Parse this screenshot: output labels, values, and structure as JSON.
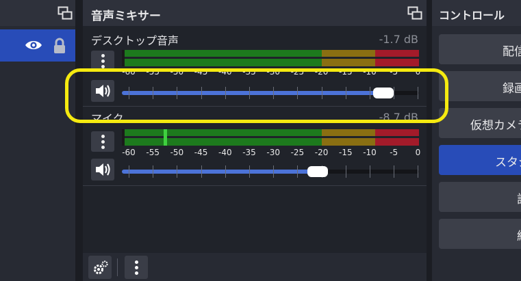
{
  "mixer": {
    "title": "音声ミキサー",
    "channels": [
      {
        "name": "デスクトップ音声",
        "db": "-1.7 dB",
        "volume": 0.88,
        "level": 0.01
      },
      {
        "name": "マイク",
        "db": "-8.7 dB",
        "volume": 0.66,
        "level": 0.14
      }
    ],
    "scale_labels": [
      "-60",
      "-55",
      "-50",
      "-45",
      "-40",
      "-35",
      "-30",
      "-25",
      "-20",
      "-15",
      "-10",
      "-5",
      "0"
    ],
    "footer": {
      "settings_icon": "gear-icon",
      "menu_icon": "kebab-menu-icon"
    }
  },
  "controls": {
    "title": "コントロール",
    "buttons": [
      {
        "label": "配信開始",
        "active": false
      },
      {
        "label": "録画開始",
        "active": false
      },
      {
        "label": "仮想カメラ開始",
        "active": false
      },
      {
        "label": "スタジオモード",
        "active": true
      },
      {
        "label": "設定",
        "active": false
      },
      {
        "label": "終了",
        "active": false
      }
    ]
  },
  "sources": {
    "visibility_icon": "eye-icon",
    "lock_icon": "lock-icon"
  },
  "colors": {
    "accent": "#284cb8",
    "meter_green": "#1d7a1d",
    "meter_yellow": "#8a6f12",
    "meter_red": "#a31b2a",
    "highlight": "#f5ea10"
  }
}
